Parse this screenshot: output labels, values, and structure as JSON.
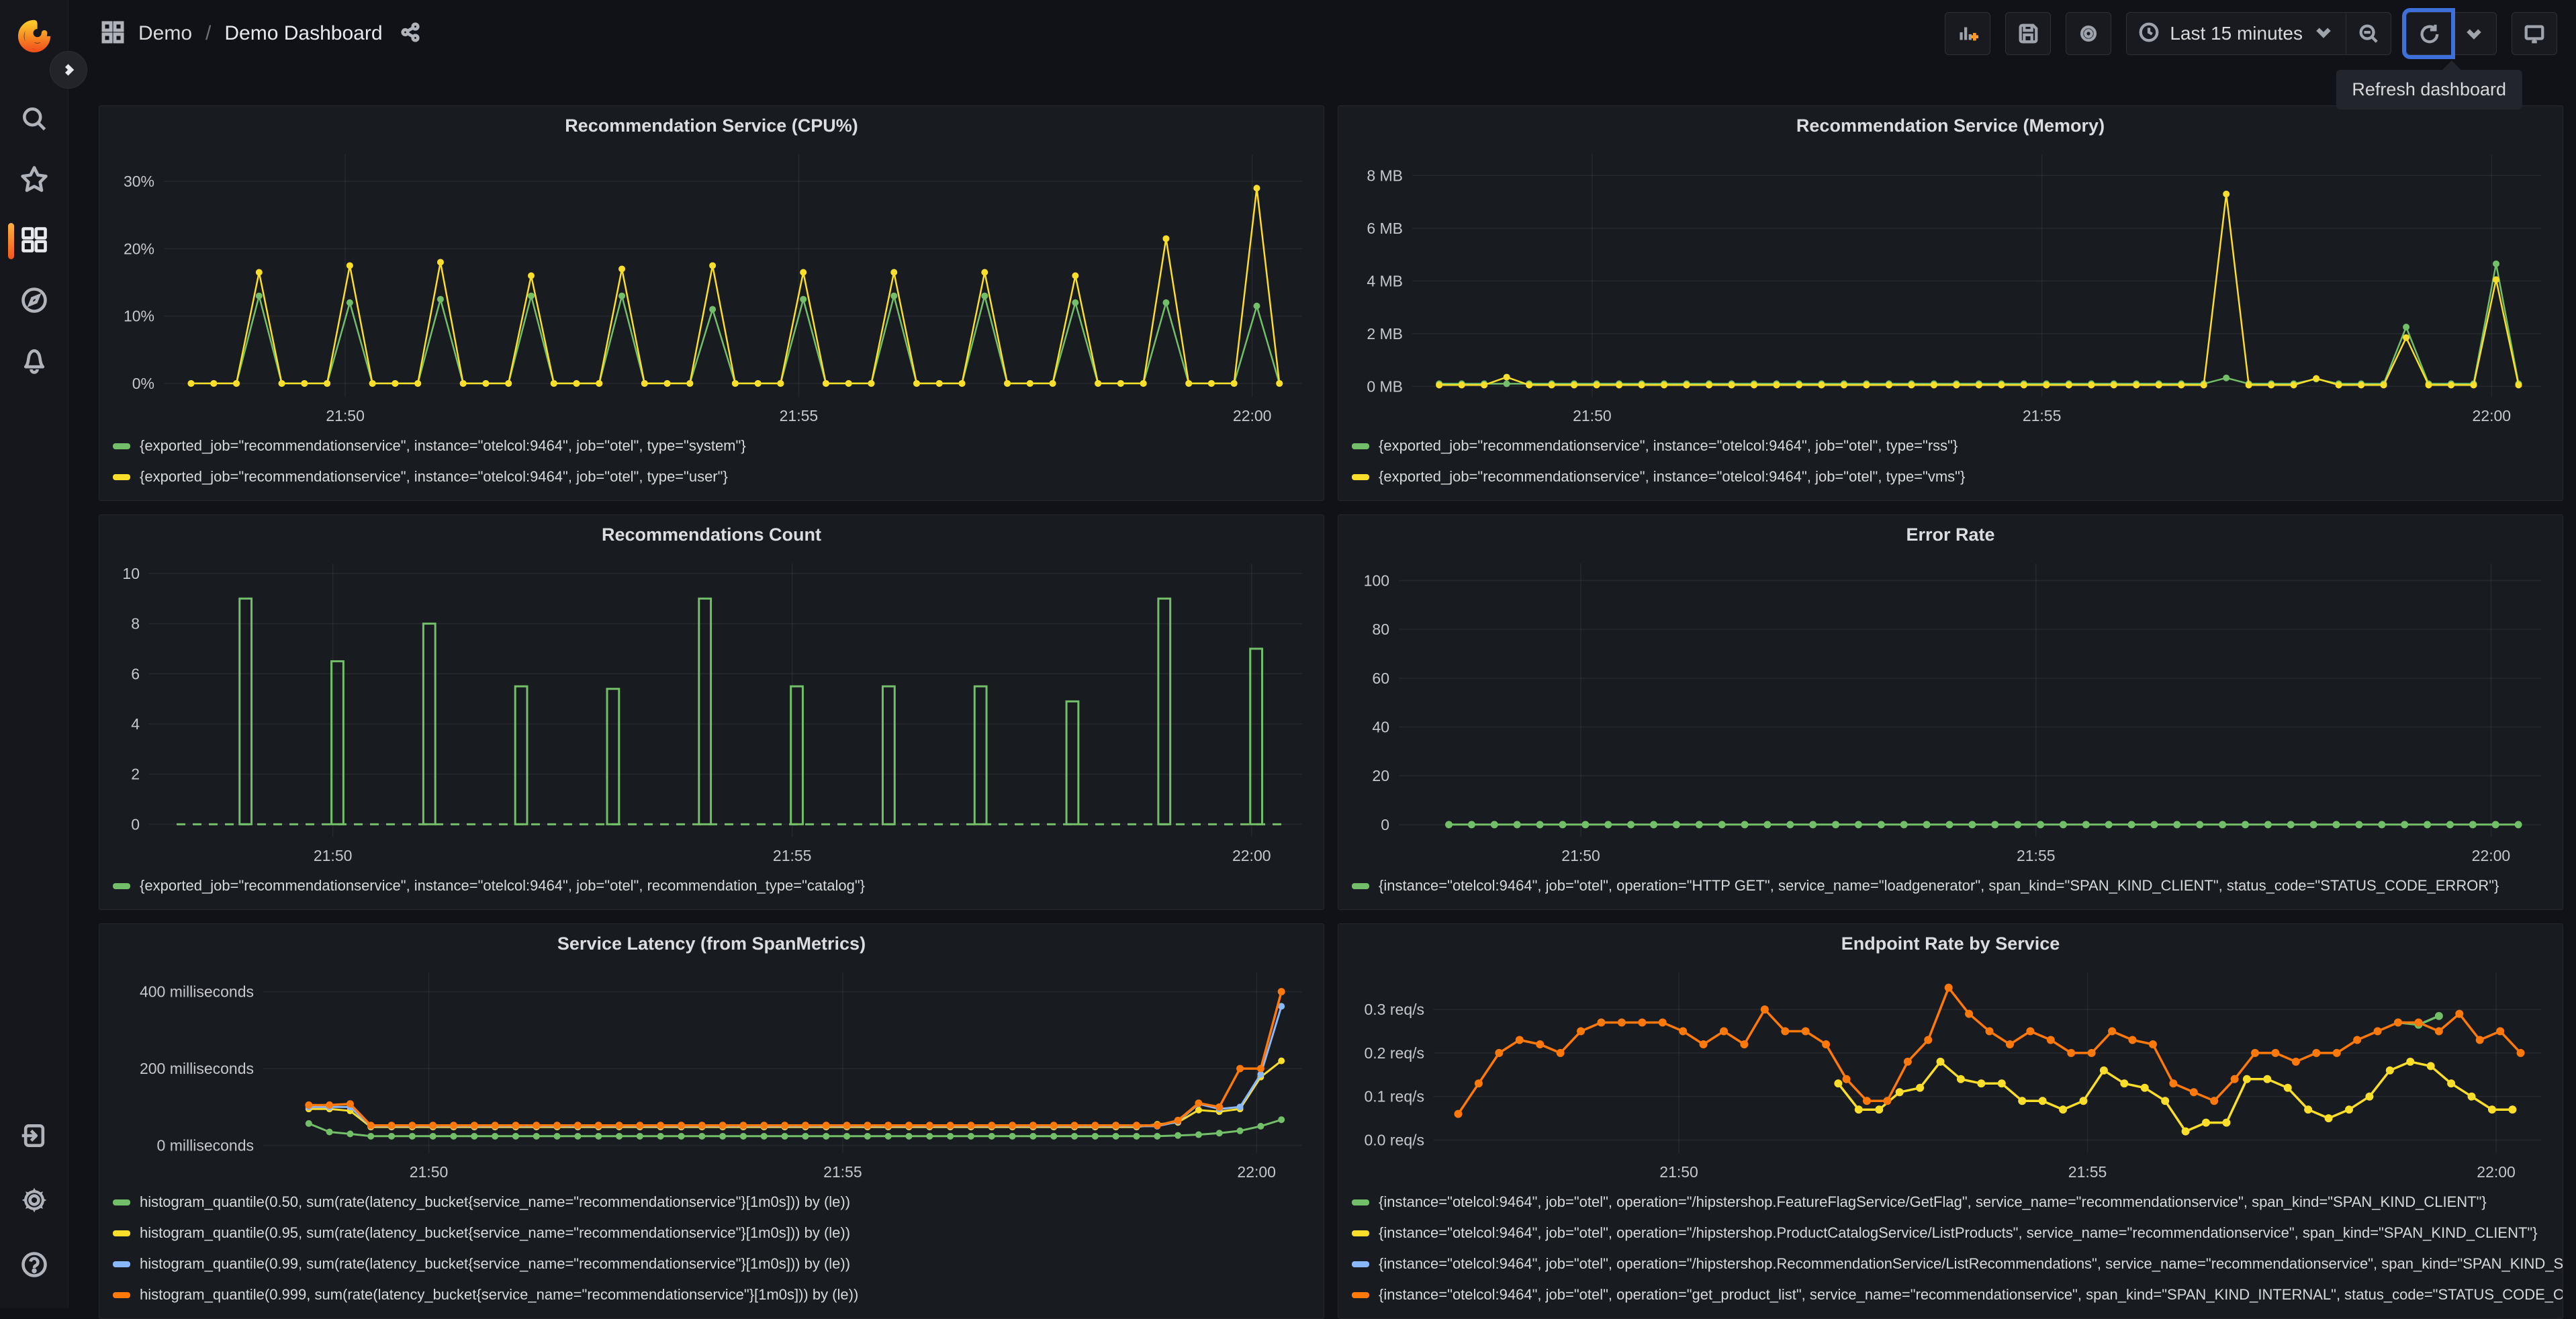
{
  "nav": {
    "breadcrumb": {
      "section": "Demo",
      "separator": "/",
      "page": "Demo Dashboard"
    },
    "toolbar": {
      "time_range": "Last 15 minutes",
      "refresh_tooltip": "Refresh dashboard"
    }
  },
  "sidebar": {
    "items": [
      "search",
      "starred",
      "dashboards",
      "explore",
      "alerting",
      "sign-in",
      "configuration",
      "help"
    ],
    "active_item": "dashboards",
    "accent_color": "#ff8833"
  },
  "colors": {
    "green": "#73BF69",
    "yellow": "#FADE2A",
    "blue": "#8AB8FF",
    "orange": "#FF780A",
    "focus_blue": "#3D71D9"
  },
  "panels": [
    {
      "title": "Recommendation Service (CPU%)",
      "legend": [
        {
          "color": "#73BF69",
          "label": "{exported_job=\"recommendationservice\", instance=\"otelcol:9464\", job=\"otel\", type=\"system\"}"
        },
        {
          "color": "#FADE2A",
          "label": "{exported_job=\"recommendationservice\", instance=\"otelcol:9464\", job=\"otel\", type=\"user\"}"
        }
      ]
    },
    {
      "title": "Recommendation Service (Memory)",
      "legend": [
        {
          "color": "#73BF69",
          "label": "{exported_job=\"recommendationservice\", instance=\"otelcol:9464\", job=\"otel\", type=\"rss\"}"
        },
        {
          "color": "#FADE2A",
          "label": "{exported_job=\"recommendationservice\", instance=\"otelcol:9464\", job=\"otel\", type=\"vms\"}"
        }
      ]
    },
    {
      "title": "Recommendations Count",
      "legend": [
        {
          "color": "#73BF69",
          "label": "{exported_job=\"recommendationservice\", instance=\"otelcol:9464\", job=\"otel\", recommendation_type=\"catalog\"}"
        }
      ]
    },
    {
      "title": "Error Rate",
      "legend": [
        {
          "color": "#73BF69",
          "label": "{instance=\"otelcol:9464\", job=\"otel\", operation=\"HTTP GET\", service_name=\"loadgenerator\", span_kind=\"SPAN_KIND_CLIENT\", status_code=\"STATUS_CODE_ERROR\"}"
        }
      ]
    },
    {
      "title": "Service Latency (from SpanMetrics)",
      "legend": [
        {
          "color": "#73BF69",
          "label": "histogram_quantile(0.50, sum(rate(latency_bucket{service_name=\"recommendationservice\"}[1m0s])) by (le))"
        },
        {
          "color": "#FADE2A",
          "label": "histogram_quantile(0.95, sum(rate(latency_bucket{service_name=\"recommendationservice\"}[1m0s])) by (le))"
        },
        {
          "color": "#8AB8FF",
          "label": "histogram_quantile(0.99, sum(rate(latency_bucket{service_name=\"recommendationservice\"}[1m0s])) by (le))"
        },
        {
          "color": "#FF780A",
          "label": "histogram_quantile(0.999, sum(rate(latency_bucket{service_name=\"recommendationservice\"}[1m0s])) by (le))"
        }
      ]
    },
    {
      "title": "Endpoint Rate by Service",
      "legend": [
        {
          "color": "#73BF69",
          "label": "{instance=\"otelcol:9464\", job=\"otel\", operation=\"/hipstershop.FeatureFlagService/GetFlag\", service_name=\"recommendationservice\", span_kind=\"SPAN_KIND_CLIENT\"}"
        },
        {
          "color": "#FADE2A",
          "label": "{instance=\"otelcol:9464\", job=\"otel\", operation=\"/hipstershop.ProductCatalogService/ListProducts\", service_name=\"recommendationservice\", span_kind=\"SPAN_KIND_CLIENT\"}"
        },
        {
          "color": "#8AB8FF",
          "label": "{instance=\"otelcol:9464\", job=\"otel\", operation=\"/hipstershop.RecommendationService/ListRecommendations\", service_name=\"recommendationservice\", span_kind=\"SPAN_KIND_SERVER\"}"
        },
        {
          "color": "#FF780A",
          "label": "{instance=\"otelcol:9464\", job=\"otel\", operation=\"get_product_list\", service_name=\"recommendationservice\", span_kind=\"SPAN_KIND_INTERNAL\", status_code=\"STATUS_CODE_OK\"}"
        }
      ]
    }
  ],
  "chart_data": [
    {
      "type": "line",
      "title": "Recommendation Service (CPU%)",
      "xlim": [
        0,
        12.55
      ],
      "ylim": [
        -2,
        34
      ],
      "padLeft": 82,
      "xticks": [
        {
          "v": 2,
          "label": "21:50"
        },
        {
          "v": 7,
          "label": "21:55"
        },
        {
          "v": 12,
          "label": "22:00"
        }
      ],
      "yticks": [
        {
          "v": 0,
          "label": "0%"
        },
        {
          "v": 10,
          "label": "10%"
        },
        {
          "v": 20,
          "label": "20%"
        },
        {
          "v": 30,
          "label": "30%"
        }
      ],
      "series": [
        {
          "name": "system",
          "color": "#73BF69",
          "lw": 2.5,
          "r": 5,
          "x0": 0.3,
          "dx": 0.25,
          "y": [
            0,
            0,
            0,
            13,
            0,
            0,
            0,
            12,
            0,
            0,
            0,
            12.5,
            0,
            0,
            0,
            13,
            0,
            0,
            0,
            13,
            0,
            0,
            0,
            11,
            0,
            0,
            0,
            12.5,
            0,
            0,
            0,
            13,
            0,
            0,
            0,
            13,
            0,
            0,
            0,
            12,
            0,
            0,
            0,
            12,
            0,
            0,
            0,
            11.5,
            0
          ]
        },
        {
          "name": "user",
          "color": "#FADE2A",
          "lw": 2.5,
          "r": 5,
          "x0": 0.3,
          "dx": 0.25,
          "y": [
            0,
            0,
            0,
            16.5,
            0,
            0,
            0,
            17.5,
            0,
            0,
            0,
            18,
            0,
            0,
            0,
            16,
            0,
            0,
            0,
            17,
            0,
            0,
            0,
            17.5,
            0,
            0,
            0,
            16.5,
            0,
            0,
            0,
            16.5,
            0,
            0,
            0,
            16.5,
            0,
            0,
            0,
            16,
            0,
            0,
            0,
            21.5,
            0,
            0,
            0,
            29,
            0
          ]
        }
      ]
    },
    {
      "type": "line",
      "title": "Recommendation Service (Memory)",
      "xlim": [
        0,
        12.55
      ],
      "ylim": [
        -0.4,
        8.8
      ],
      "padLeft": 96,
      "xticks": [
        {
          "v": 2,
          "label": "21:50"
        },
        {
          "v": 7,
          "label": "21:55"
        },
        {
          "v": 12,
          "label": "22:00"
        }
      ],
      "yticks": [
        {
          "v": 0,
          "label": "0 MB"
        },
        {
          "v": 2,
          "label": "2 MB"
        },
        {
          "v": 4,
          "label": "4 MB"
        },
        {
          "v": 6,
          "label": "6 MB"
        },
        {
          "v": 8,
          "label": "8 MB"
        }
      ],
      "series": [
        {
          "name": "rss",
          "color": "#73BF69",
          "lw": 2.5,
          "r": 5,
          "x0": 0.3,
          "dx": 0.25,
          "y": [
            0.1,
            0.1,
            0.1,
            0.1,
            0.1,
            0.1,
            0.1,
            0.1,
            0.1,
            0.1,
            0.1,
            0.1,
            0.1,
            0.1,
            0.1,
            0.1,
            0.1,
            0.1,
            0.1,
            0.1,
            0.1,
            0.1,
            0.1,
            0.1,
            0.1,
            0.1,
            0.1,
            0.1,
            0.1,
            0.1,
            0.1,
            0.1,
            0.1,
            0.1,
            0.1,
            0.32,
            0.1,
            0.1,
            0.1,
            0.28,
            0.1,
            0.1,
            0.1,
            2.25,
            0.1,
            0.1,
            0.1,
            4.65,
            0.1
          ]
        },
        {
          "name": "vms",
          "color": "#FADE2A",
          "lw": 2.5,
          "r": 5,
          "x0": 0.3,
          "dx": 0.25,
          "y": [
            0.05,
            0.05,
            0.05,
            0.35,
            0.05,
            0.05,
            0.05,
            0.05,
            0.05,
            0.05,
            0.05,
            0.05,
            0.05,
            0.05,
            0.05,
            0.05,
            0.05,
            0.05,
            0.05,
            0.05,
            0.05,
            0.05,
            0.05,
            0.05,
            0.05,
            0.05,
            0.05,
            0.05,
            0.05,
            0.05,
            0.05,
            0.05,
            0.05,
            0.05,
            0.05,
            7.3,
            0.05,
            0.05,
            0.05,
            0.3,
            0.05,
            0.05,
            0.05,
            1.85,
            0.05,
            0.05,
            0.05,
            4.05,
            0.05
          ]
        }
      ]
    },
    {
      "type": "bar",
      "title": "Recommendations Count",
      "xlim": [
        0,
        12.55
      ],
      "ylim": [
        -0.5,
        10.4
      ],
      "padLeft": 60,
      "xticks": [
        {
          "v": 2,
          "label": "21:50"
        },
        {
          "v": 7,
          "label": "21:55"
        },
        {
          "v": 12,
          "label": "22:00"
        }
      ],
      "yticks": [
        {
          "v": 0,
          "label": "0"
        },
        {
          "v": 2,
          "label": "2"
        },
        {
          "v": 4,
          "label": "4"
        },
        {
          "v": 6,
          "label": "6"
        },
        {
          "v": 8,
          "label": "8"
        },
        {
          "v": 10,
          "label": "10"
        }
      ],
      "bar_color": "#73BF69",
      "bar_width_min": 0.13,
      "zero_dash": {
        "from": 0.3,
        "to": 12.4
      },
      "bars": {
        "x": [
          1.05,
          2.05,
          3.05,
          4.05,
          5.05,
          6.05,
          7.05,
          8.05,
          9.05,
          10.05,
          11.05,
          12.05
        ],
        "values": [
          9,
          6.5,
          8,
          5.5,
          5.4,
          9,
          5.5,
          5.5,
          5.5,
          4.9,
          9,
          7
        ]
      }
    },
    {
      "type": "line",
      "title": "Error Rate",
      "xlim": [
        0,
        12.55
      ],
      "ylim": [
        -5,
        107
      ],
      "padLeft": 76,
      "xticks": [
        {
          "v": 2,
          "label": "21:50"
        },
        {
          "v": 7,
          "label": "21:55"
        },
        {
          "v": 12,
          "label": "22:00"
        }
      ],
      "yticks": [
        {
          "v": 0,
          "label": "0"
        },
        {
          "v": 20,
          "label": "20"
        },
        {
          "v": 40,
          "label": "40"
        },
        {
          "v": 60,
          "label": "60"
        },
        {
          "v": 80,
          "label": "80"
        },
        {
          "v": 100,
          "label": "100"
        }
      ],
      "series": [
        {
          "name": "error-rate",
          "color": "#73BF69",
          "lw": 3,
          "r": 5.5,
          "x0": 0.55,
          "dx": 0.25,
          "const": 0,
          "n": 48
        }
      ]
    },
    {
      "type": "line",
      "title": "Service Latency (from SpanMetrics)",
      "xlim": [
        0,
        12.55
      ],
      "ylim": [
        -20,
        450
      ],
      "padLeft": 230,
      "xticks": [
        {
          "v": 2,
          "label": "21:50"
        },
        {
          "v": 7,
          "label": "21:55"
        },
        {
          "v": 12,
          "label": "22:00"
        }
      ],
      "yticks": [
        {
          "v": 0,
          "label": "0 milliseconds"
        },
        {
          "v": 200,
          "label": "200 milliseconds"
        },
        {
          "v": 400,
          "label": "400 milliseconds"
        }
      ],
      "series": [
        {
          "name": "p50",
          "color": "#73BF69",
          "lw": 3,
          "r": 5,
          "markerEvery": 0.25,
          "points": [
            [
              0.55,
              57
            ],
            [
              0.8,
              35
            ],
            [
              1.05,
              30
            ],
            [
              1.3,
              24
            ],
            [
              10.8,
              24
            ],
            [
              11.05,
              26
            ],
            [
              11.3,
              28
            ],
            [
              11.55,
              32
            ],
            [
              11.8,
              38
            ],
            [
              12.05,
              50
            ],
            [
              12.3,
              67
            ]
          ]
        },
        {
          "name": "p95",
          "color": "#FADE2A",
          "lw": 3,
          "r": 5,
          "markerEvery": 0.25,
          "points": [
            [
              0.55,
              95
            ],
            [
              0.8,
              95
            ],
            [
              1.05,
              90
            ],
            [
              1.3,
              48
            ],
            [
              10.55,
              48
            ],
            [
              10.8,
              55
            ],
            [
              11.05,
              60
            ],
            [
              11.3,
              92
            ],
            [
              11.55,
              88
            ],
            [
              11.8,
              95
            ],
            [
              12.05,
              178
            ],
            [
              12.3,
              220
            ]
          ]
        },
        {
          "name": "p99",
          "color": "#8AB8FF",
          "lw": 3,
          "r": 5,
          "markerEvery": 0.25,
          "points": [
            [
              0.55,
              100
            ],
            [
              0.8,
              100
            ],
            [
              1.05,
              100
            ],
            [
              1.3,
              50
            ],
            [
              10.8,
              50
            ],
            [
              11.05,
              62
            ],
            [
              11.3,
              108
            ],
            [
              11.55,
              95
            ],
            [
              11.8,
              100
            ],
            [
              12.05,
              185
            ],
            [
              12.3,
              362
            ]
          ]
        },
        {
          "name": "p999",
          "color": "#FF780A",
          "lw": 3.5,
          "r": 5.5,
          "markerEvery": 0.25,
          "points": [
            [
              0.55,
              105
            ],
            [
              0.8,
              105
            ],
            [
              1.05,
              108
            ],
            [
              1.3,
              52
            ],
            [
              10.8,
              52
            ],
            [
              11.05,
              65
            ],
            [
              11.3,
              110
            ],
            [
              11.55,
              100
            ],
            [
              11.8,
              200
            ],
            [
              12.05,
              200
            ],
            [
              12.3,
              400
            ]
          ]
        }
      ]
    },
    {
      "type": "line",
      "title": "Endpoint Rate by Service",
      "xlim": [
        -1,
        12.55
      ],
      "ylim": [
        -0.03,
        0.385
      ],
      "padLeft": 128,
      "xticks": [
        {
          "v": 2,
          "label": "21:50"
        },
        {
          "v": 7,
          "label": "21:55"
        },
        {
          "v": 12,
          "label": "22:00"
        }
      ],
      "yticks": [
        {
          "v": 0,
          "label": "0.0 req/s"
        },
        {
          "v": 0.1,
          "label": "0.1 req/s"
        },
        {
          "v": 0.2,
          "label": "0.2 req/s"
        },
        {
          "v": 0.3,
          "label": "0.3 req/s"
        }
      ],
      "series": [
        {
          "name": "GetFlag",
          "color": "#73BF69",
          "lw": 3.5,
          "r": 6,
          "points": [
            [
              10.8,
              0.27
            ],
            [
              11.05,
              0.265
            ],
            [
              11.3,
              0.285
            ]
          ]
        },
        {
          "name": "ListProducts",
          "color": "#FADE2A",
          "lw": 3.5,
          "r": 6,
          "x0": 3.95,
          "dx": 0.25,
          "y": [
            0.13,
            0.07,
            0.07,
            0.11,
            0.12,
            0.18,
            0.14,
            0.13,
            0.13,
            0.09,
            0.09,
            0.07,
            0.09,
            0.16,
            0.13,
            0.12,
            0.09,
            0.02,
            0.04,
            0.04,
            0.14,
            0.14,
            0.12,
            0.07,
            0.05,
            0.07,
            0.1,
            0.16,
            0.18,
            0.17,
            0.13,
            0.1,
            0.07,
            0.07
          ]
        },
        {
          "name": "ListRecommendations",
          "color": "#8AB8FF",
          "lw": 3.5,
          "r": 6,
          "points": []
        },
        {
          "name": "get_product_list",
          "color": "#FF780A",
          "lw": 3.5,
          "r": 6,
          "x0": -0.7,
          "dx": 0.25,
          "y": [
            0.06,
            0.13,
            0.2,
            0.23,
            0.22,
            0.2,
            0.25,
            0.27,
            0.27,
            0.27,
            0.27,
            0.25,
            0.22,
            0.25,
            0.22,
            0.3,
            0.25,
            0.25,
            0.22,
            0.14,
            0.09,
            0.09,
            0.18,
            0.23,
            0.35,
            0.29,
            0.25,
            0.22,
            0.25,
            0.23,
            0.2,
            0.2,
            0.25,
            0.23,
            0.22,
            0.13,
            0.11,
            0.09,
            0.14,
            0.2,
            0.2,
            0.18,
            0.2,
            0.2,
            0.23,
            0.25,
            0.27,
            0.27,
            0.25,
            0.29,
            0.23,
            0.25,
            0.2
          ]
        }
      ]
    }
  ]
}
